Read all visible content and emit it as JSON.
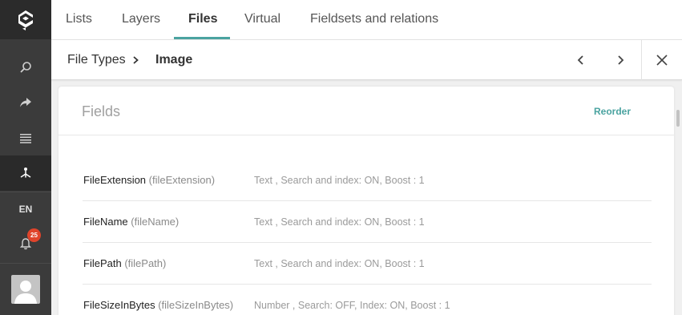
{
  "sidebar": {
    "logo_icon": "app-logo-icon",
    "buttons": [
      "search-icon",
      "share-arrow-icon",
      "list-icon",
      "hierarchy-icon"
    ],
    "language": "EN",
    "notifications_count": "25"
  },
  "tabs": [
    {
      "label": "Lists"
    },
    {
      "label": "Layers"
    },
    {
      "label": "Files"
    },
    {
      "label": "Virtual"
    },
    {
      "label": "Fieldsets and relations"
    }
  ],
  "breadcrumb": {
    "parent": "File Types",
    "current": "Image"
  },
  "panel": {
    "title": "Fields",
    "reorder_label": "Reorder",
    "fields": [
      {
        "name": "FileExtension",
        "key": "(fileExtension)",
        "description": "Text ,   Search and index: ON,   Boost : 1"
      },
      {
        "name": "FileName",
        "key": "(fileName)",
        "description": "Text ,   Search and index: ON,   Boost : 1"
      },
      {
        "name": "FilePath",
        "key": "(filePath)",
        "description": "Text ,   Search and index: ON,   Boost : 1"
      },
      {
        "name": "FileSizeInBytes",
        "key": "(fileSizeInBytes)",
        "description": "Number ,   Search: OFF, Index: ON,   Boost : 1"
      }
    ]
  },
  "colors": {
    "accent": "#4aa3a0",
    "sidebar": "#3b3b3b",
    "badge": "#e0442b"
  }
}
